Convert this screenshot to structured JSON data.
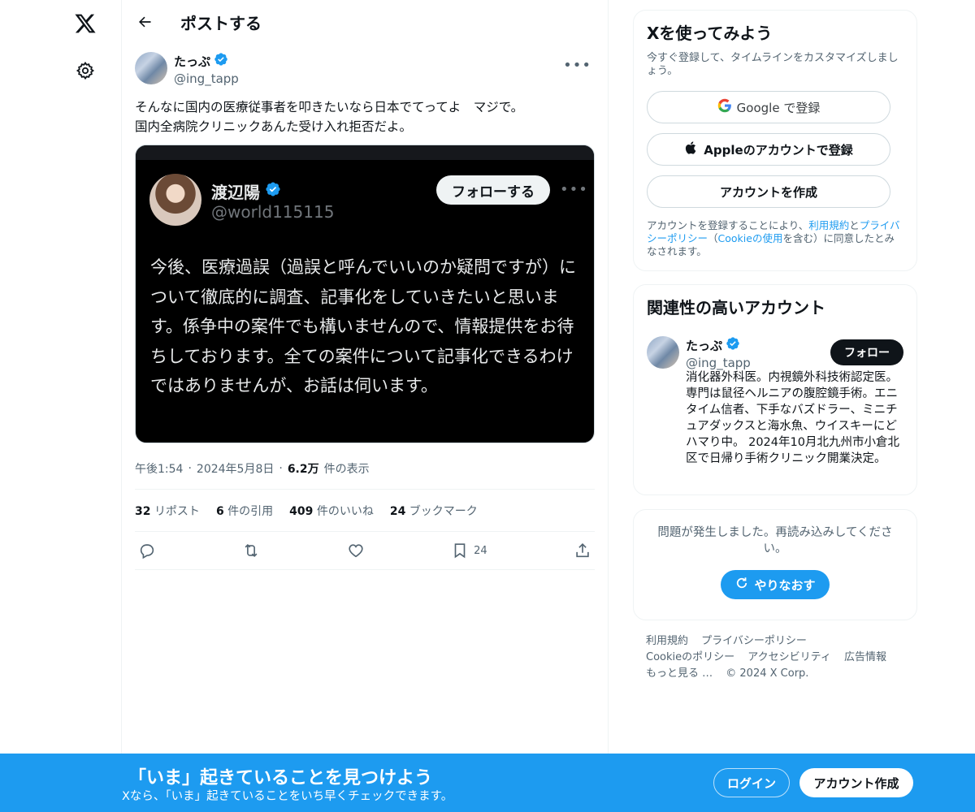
{
  "header": {
    "title": "ポストする"
  },
  "post": {
    "author_name": "たっぷ",
    "author_handle": "@ing_tapp",
    "text": "そんなに国内の医療従事者を叩きたいなら日本でてってよ　マジで。\n国内全病院クリニックあんた受け入れ拒否だよ。",
    "embed": {
      "name": "渡辺陽",
      "handle": "@world115115",
      "follow_label": "フォローする",
      "text": "今後、医療過誤（過誤と呼んでいいのか疑問ですが）について徹底的に調査、記事化をしていきたいと思います。係争中の案件でも構いませんので、情報提供をお待ちしております。全ての案件について記事化できるわけではありませんが、お話は伺います。"
    },
    "time": "午後1:54",
    "date": "2024年5月8日",
    "views_count": "6.2万",
    "views_label": "件の表示",
    "stats": [
      {
        "count": "32",
        "label": "リポスト"
      },
      {
        "count": "6",
        "label": "件の引用"
      },
      {
        "count": "409",
        "label": "件のいいね"
      },
      {
        "count": "24",
        "label": "ブックマーク"
      }
    ],
    "bookmark_count": "24"
  },
  "signup": {
    "title": "Xを使ってみよう",
    "subtitle": "今すぐ登録して、タイムラインをカスタマイズしましょう。",
    "google_label": "Google で登録",
    "apple_label": "Appleのアカウントで登録",
    "create_label": "アカウントを作成",
    "legal_prefix": "アカウントを登録することにより、",
    "terms": "利用規約",
    "and": "と",
    "privacy": "プライバシーポリシー",
    "paren_open": "（",
    "cookie": "Cookieの使用",
    "legal_suffix": "を含む）に同意したとみなされます。"
  },
  "related": {
    "title": "関連性の高いアカウント",
    "name": "たっぷ",
    "handle": "@ing_tapp",
    "follow_label": "フォロー",
    "bio": "消化器外科医。内視鏡外科技術認定医。専門は鼠径ヘルニアの腹腔鏡手術。エニタイム信者、下手なバズドラー、ミニチュアダックスと海水魚、ウイスキーにどハマり中。 2024年10月北九州市小倉北区で日帰り手術クリニック開業決定。"
  },
  "problem": {
    "text": "問題が発生しました。再読み込みしてください。",
    "retry_label": "やりなおす"
  },
  "footer": {
    "links": [
      "利用規約",
      "プライバシーポリシー",
      "Cookieのポリシー",
      "アクセシビリティ",
      "広告情報",
      "もっと見る …"
    ],
    "copyright": "© 2024 X Corp."
  },
  "banner": {
    "title": "「いま」起きていることを見つけよう",
    "subtitle": "Xなら、「いま」起きていることをいち早くチェックできます。",
    "login_label": "ログイン",
    "create_label": "アカウント作成"
  },
  "colors": {
    "accent": "#1d9bf0",
    "verified": "#1d9bf0",
    "text": "#0f1419",
    "muted": "#536471"
  },
  "icons": [
    "x-logo-icon",
    "gear-icon",
    "back-arrow-icon",
    "verified-badge-icon",
    "more-icon",
    "reply-icon",
    "repost-icon",
    "like-icon",
    "bookmark-icon",
    "share-icon",
    "google-icon",
    "apple-icon",
    "refresh-icon"
  ]
}
